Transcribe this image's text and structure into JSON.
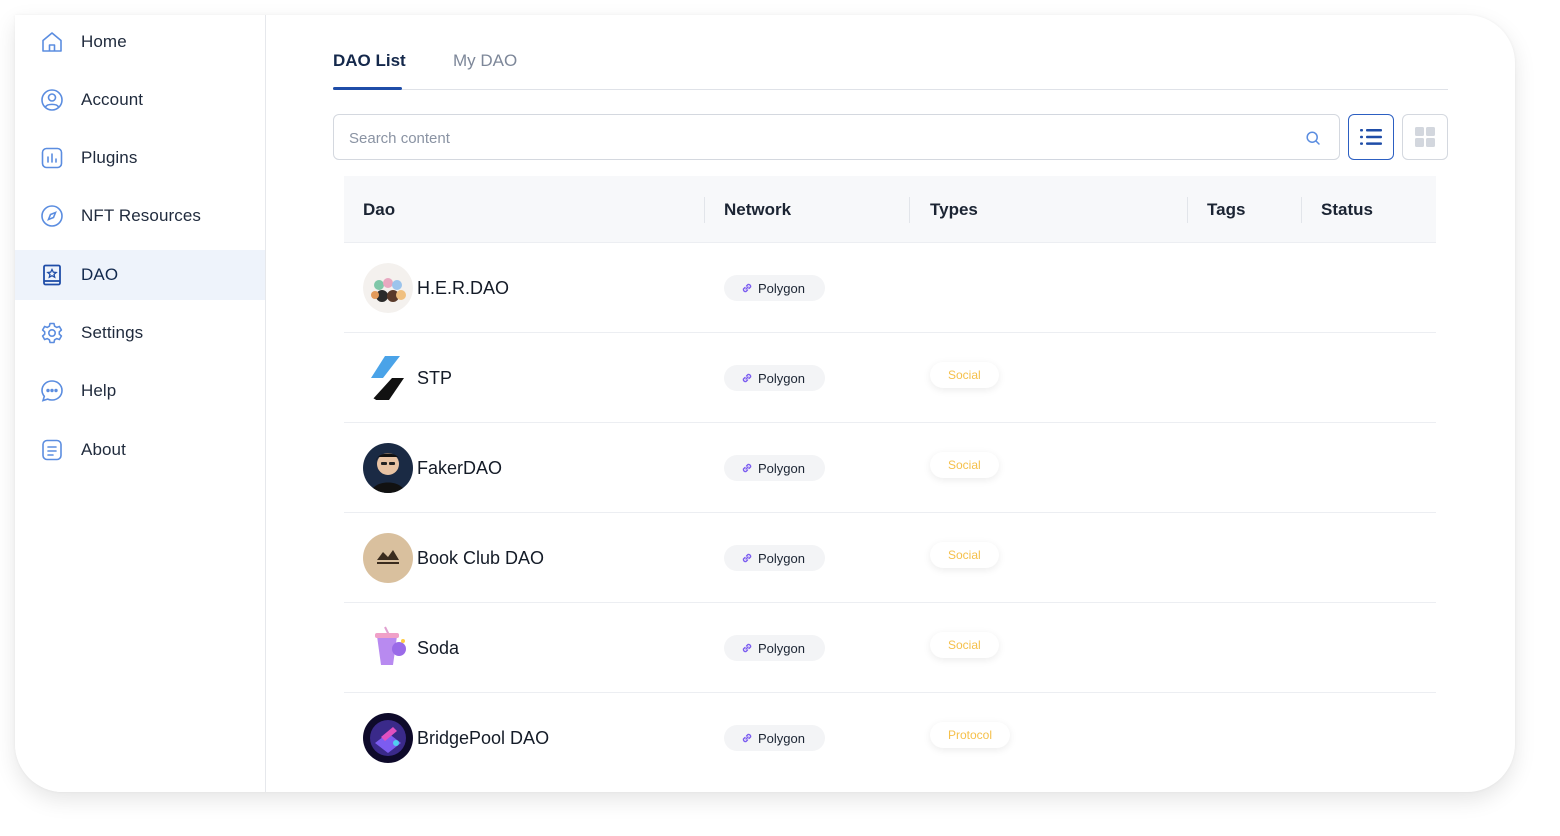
{
  "sidebar": {
    "items": [
      {
        "label": "Home",
        "icon": "home-icon"
      },
      {
        "label": "Account",
        "icon": "user-icon"
      },
      {
        "label": "Plugins",
        "icon": "chart-icon"
      },
      {
        "label": "NFT Resources",
        "icon": "compass-icon"
      },
      {
        "label": "DAO",
        "icon": "dao-icon",
        "active": true
      },
      {
        "label": "Settings",
        "icon": "gear-icon"
      },
      {
        "label": "Help",
        "icon": "chat-icon"
      },
      {
        "label": "About",
        "icon": "document-icon"
      }
    ]
  },
  "tabs": [
    {
      "label": "DAO List",
      "active": true
    },
    {
      "label": "My DAO",
      "active": false
    }
  ],
  "search": {
    "placeholder": "Search content",
    "value": ""
  },
  "table": {
    "columns": [
      "Dao",
      "Network",
      "Types",
      "Tags",
      "Status"
    ],
    "rows": [
      {
        "name": "H.E.R.DAO",
        "network": "Polygon",
        "type": "",
        "tags": "",
        "status": ""
      },
      {
        "name": "STP",
        "network": "Polygon",
        "type": "Social",
        "tags": "",
        "status": ""
      },
      {
        "name": "FakerDAO",
        "network": "Polygon",
        "type": "Social",
        "tags": "",
        "status": ""
      },
      {
        "name": "Book Club DAO",
        "network": "Polygon",
        "type": "Social",
        "tags": "",
        "status": ""
      },
      {
        "name": "Soda",
        "network": "Polygon",
        "type": "Social",
        "tags": "",
        "status": ""
      },
      {
        "name": "BridgePool DAO",
        "network": "Polygon",
        "type": "Protocol",
        "tags": "",
        "status": ""
      }
    ]
  },
  "colors": {
    "accent": "#1f4da8",
    "active_nav_bg": "#eef3fb",
    "type_text": "#f5c04a",
    "network_icon": "#7b5cf0"
  }
}
